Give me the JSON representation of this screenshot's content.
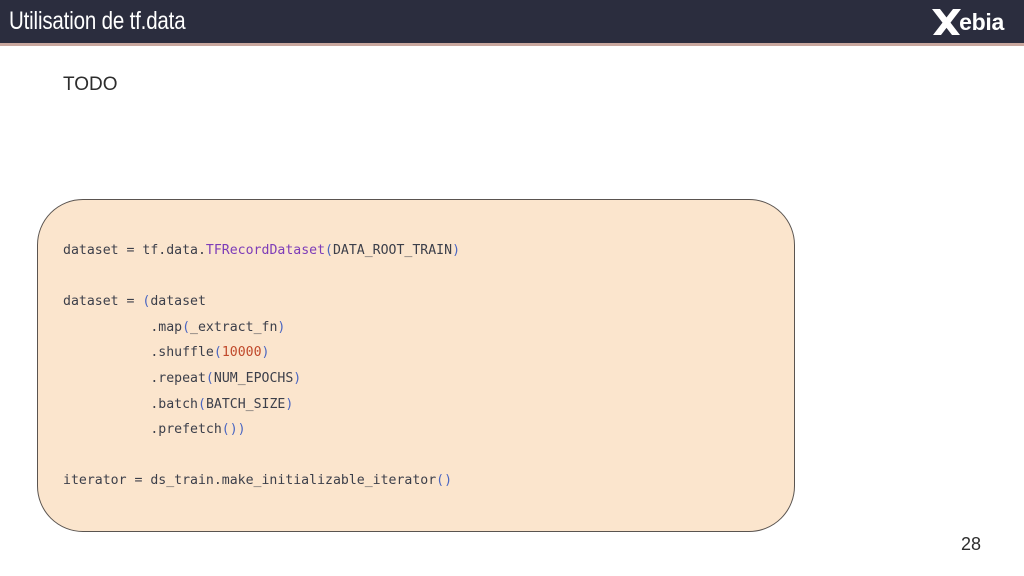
{
  "header": {
    "title": "Utilisation de tf.data",
    "logo_text": "ebia"
  },
  "body": {
    "text": "TODO"
  },
  "code": {
    "l1_a": "dataset = tf.data.",
    "l1_fn": "TFRecordDataset",
    "l1_po": "(",
    "l1_arg": "DATA_ROOT_TRAIN",
    "l1_pc": ")",
    "l3_a": "dataset = ",
    "l3_po": "(",
    "l3_b": "dataset",
    "l4_a": "           .map",
    "l4_po": "(",
    "l4_arg": "_extract_fn",
    "l4_pc": ")",
    "l5_a": "           .shuffle",
    "l5_po": "(",
    "l5_arg": "10000",
    "l5_pc": ")",
    "l6_a": "           .repeat",
    "l6_po": "(",
    "l6_arg": "NUM_EPOCHS",
    "l6_pc": ")",
    "l7_a": "           .batch",
    "l7_po": "(",
    "l7_arg": "BATCH_SIZE",
    "l7_pc": ")",
    "l8_a": "           .prefetch",
    "l8_p": "())",
    "l10_a": "iterator = ds_train.make_initializable_iterator",
    "l10_p": "()"
  },
  "footer": {
    "page_number": "28"
  },
  "colors": {
    "header_bg": "#2b2d3e",
    "code_bg": "#fbe5cd",
    "function": "#7d3cb8",
    "paren": "#4a66c2",
    "number": "#c0492b"
  }
}
